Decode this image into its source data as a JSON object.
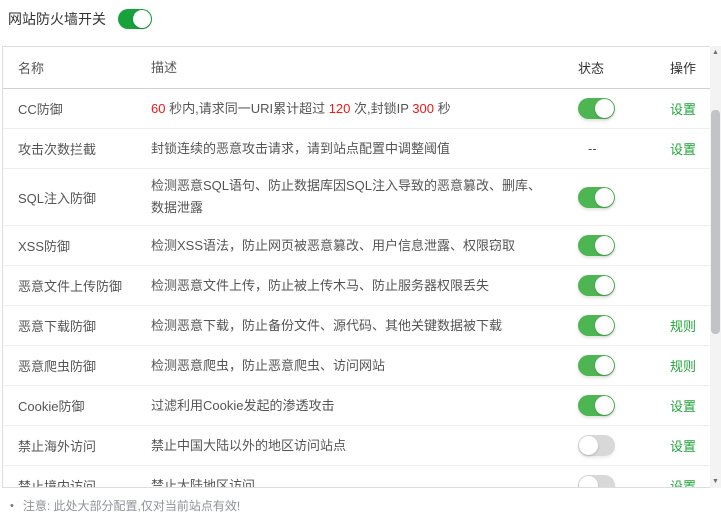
{
  "page": {
    "title": "网站防火墙开关",
    "master_switch": "on"
  },
  "colors": {
    "accent_green": "#20a53a",
    "master_toggle_on": "#17a23b",
    "toggle_on": "#4db652",
    "toggle_off": "#d8d8d8",
    "red_number": "#f21717"
  },
  "table": {
    "headers": {
      "name": "名称",
      "desc": "描述",
      "status": "状态",
      "action": "操作"
    },
    "rows": [
      {
        "name": "CC防御",
        "desc": [
          {
            "t": "60",
            "red": true
          },
          {
            "t": " 秒内,请求同一URI累计超过 "
          },
          {
            "t": "120",
            "red": true
          },
          {
            "t": " 次,封锁IP "
          },
          {
            "t": "300",
            "red": true
          },
          {
            "t": " 秒"
          }
        ],
        "status": "on",
        "action": "设置"
      },
      {
        "name": "攻击次数拦截",
        "desc": [
          {
            "t": "封锁连续的恶意攻击请求，请到站点配置中调整阈值"
          }
        ],
        "status": "--",
        "action": "设置"
      },
      {
        "name": "SQL注入防御",
        "desc": [
          {
            "t": "检测恶意SQL语句、防止数据库因SQL注入导致的恶意篡改、删库、数据泄露"
          }
        ],
        "status": "on",
        "action": ""
      },
      {
        "name": "XSS防御",
        "desc": [
          {
            "t": "检测XSS语法，防止网页被恶意篡改、用户信息泄露、权限窃取"
          }
        ],
        "status": "on",
        "action": ""
      },
      {
        "name": "恶意文件上传防御",
        "desc": [
          {
            "t": "检测恶意文件上传，防止被上传木马、防止服务器权限丢失"
          }
        ],
        "status": "on",
        "action": ""
      },
      {
        "name": "恶意下载防御",
        "desc": [
          {
            "t": "检测恶意下载，防止备份文件、源代码、其他关键数据被下载"
          }
        ],
        "status": "on",
        "action": "规则"
      },
      {
        "name": "恶意爬虫防御",
        "desc": [
          {
            "t": "检测恶意爬虫，防止恶意爬虫、访问网站"
          }
        ],
        "status": "on",
        "action": "规则"
      },
      {
        "name": "Cookie防御",
        "desc": [
          {
            "t": "过滤利用Cookie发起的渗透攻击"
          }
        ],
        "status": "on",
        "action": "设置"
      },
      {
        "name": "禁止海外访问",
        "desc": [
          {
            "t": "禁止中国大陆以外的地区访问站点"
          }
        ],
        "status": "off",
        "action": "设置"
      },
      {
        "name": "禁止境内访问",
        "desc": [
          {
            "t": "禁止大陆地区访问"
          }
        ],
        "status": "off",
        "action": "设置"
      }
    ]
  },
  "footer": {
    "bullet": "•",
    "note": "注意: 此处大部分配置,仅对当前站点有效!"
  },
  "icons": {
    "scroll_up": "▲",
    "scroll_down": "▼"
  }
}
